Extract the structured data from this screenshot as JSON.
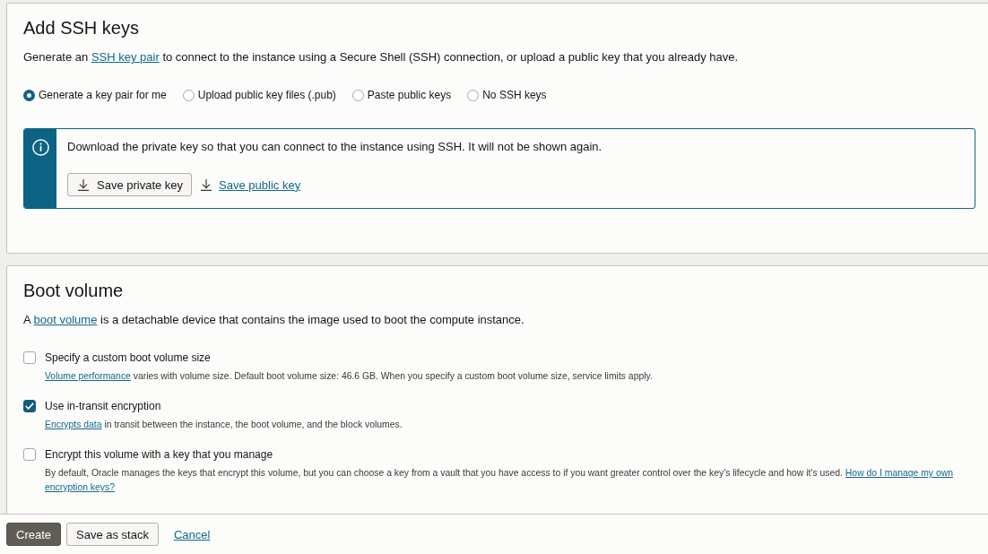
{
  "ssh_keys": {
    "title": "Add SSH keys",
    "description": [
      {
        "kind": "text",
        "text": "Generate an"
      },
      {
        "kind": "link",
        "text": "SSH key pair"
      },
      {
        "kind": "text",
        "text": "to connect to the instance using a Secure Shell (SSH) connection, or upload a public key that you already have."
      }
    ],
    "key_options": [
      {
        "label": "Generate a key pair for me",
        "selected": true
      },
      {
        "label": "Upload public key files (.pub)",
        "selected": false
      },
      {
        "label": "Paste public keys",
        "selected": false
      },
      {
        "label": "No SSH keys",
        "selected": false
      }
    ],
    "notice": {
      "message": "Download the private key so that you can connect to the instance using SSH. It will not be shown again.",
      "actions": [
        {
          "kind": "button",
          "label": "Save private key"
        },
        {
          "kind": "link",
          "label": "Save public key"
        }
      ]
    }
  },
  "boot_volume": {
    "title": "Boot volume",
    "description": [
      {
        "kind": "text",
        "text": "A"
      },
      {
        "kind": "link",
        "text": "boot volume"
      },
      {
        "kind": "text",
        "text": "is a detachable device that contains the image used to boot the compute instance."
      }
    ],
    "options": [
      {
        "label": "Specify a custom boot volume size",
        "checked": false,
        "help": [
          {
            "kind": "link",
            "text": "Volume performance"
          },
          {
            "kind": "text",
            "text": "varies with volume size. Default boot volume size: 46.6 GB. When you specify a custom boot volume size, service limits apply."
          }
        ]
      },
      {
        "label": "Use in-transit encryption",
        "checked": true,
        "help": [
          {
            "kind": "link",
            "text": "Encrypts data"
          },
          {
            "kind": "text",
            "text": "in transit between the instance, the boot volume, and the block volumes."
          }
        ]
      },
      {
        "label": "Encrypt this volume with a key that you manage",
        "checked": false,
        "help": [
          {
            "kind": "text",
            "text": "By default, Oracle manages the keys that encrypt this volume, but you can choose a key from a vault that you have access to if you want greater control over the key's lifecycle and how it's used."
          },
          {
            "kind": "link",
            "text": "How do I manage my own"
          },
          {
            "kind": "link",
            "text": "encryption keys?"
          }
        ]
      }
    ]
  },
  "footer": {
    "actions": [
      {
        "kind": "primary",
        "label": "Create"
      },
      {
        "kind": "secondary",
        "label": "Save as stack"
      },
      {
        "kind": "link",
        "label": "Cancel"
      }
    ]
  }
}
